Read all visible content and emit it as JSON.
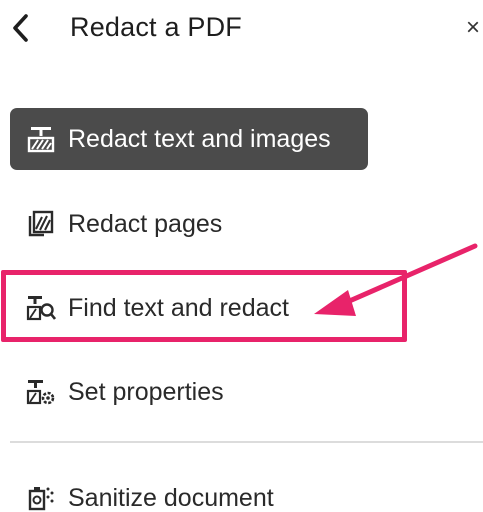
{
  "header": {
    "title": "Redact a PDF",
    "close_glyph": "×",
    "back_icon": "chevron-left-icon"
  },
  "menu": {
    "items": [
      {
        "label": "Redact text and images",
        "icon": "redact-text-images-icon",
        "active": true
      },
      {
        "label": "Redact pages",
        "icon": "redact-pages-icon",
        "active": false
      },
      {
        "label": "Find text and redact",
        "icon": "find-text-redact-icon",
        "active": false,
        "highlighted": true
      },
      {
        "label": "Set properties",
        "icon": "set-properties-icon",
        "active": false
      },
      {
        "label": "Sanitize document",
        "icon": "sanitize-document-icon",
        "active": false
      }
    ]
  },
  "annotation": {
    "color": "#e8236a"
  },
  "colors": {
    "active_bg": "#4b4b4b",
    "active_text": "#ffffff",
    "text": "#2a2a2a"
  }
}
